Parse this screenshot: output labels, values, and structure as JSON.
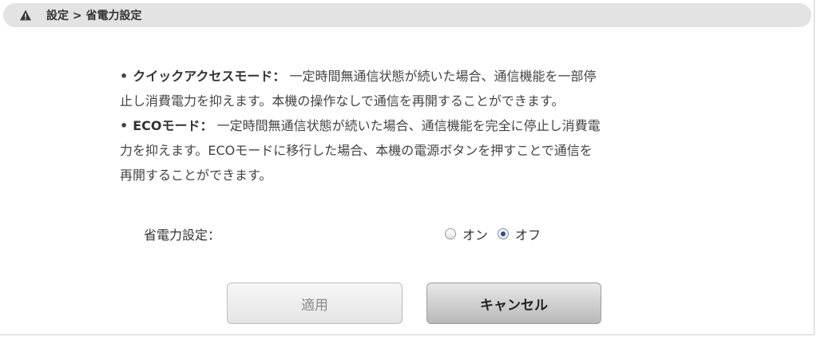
{
  "header": {
    "breadcrumb": "設定 > 省電力設定",
    "icon": "warning-icon"
  },
  "description": {
    "bullet": "•",
    "item1": {
      "term": "クイックアクセスモード：",
      "line1_text": " 一定時間無通信状態が続いた場合、通信機能を一部停",
      "line2_text": "止し消費電力を抑えます。本機の操作なしで通信を再開することができます。"
    },
    "item2": {
      "term": "ECOモード：",
      "line1_text": " 一定時間無通信状態が続いた場合、通信機能を完全に停止し消費電",
      "line2_text": "力を抑えます。ECOモードに移行した場合、本機の電源ボタンを押すことで通信を",
      "line3_text": "再開することができます。"
    }
  },
  "power_setting": {
    "label": "省電力設定：",
    "options": [
      {
        "label": "オン",
        "selected": false
      },
      {
        "label": "オフ",
        "selected": true
      }
    ]
  },
  "buttons": {
    "apply_label": "適用",
    "cancel_label": "キャンセル"
  }
}
